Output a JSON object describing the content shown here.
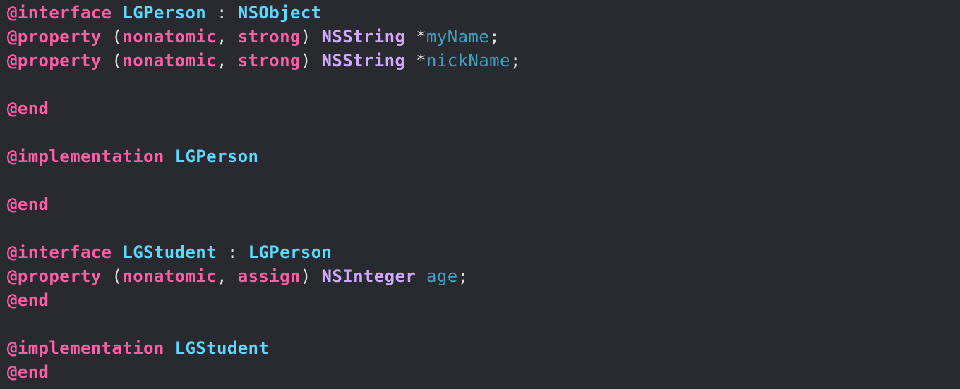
{
  "code": {
    "line1": {
      "kw": "@interface",
      "cls": "LGPerson",
      "colon": " : ",
      "sup": "NSObject"
    },
    "line2": {
      "kw": "@property",
      "open": " (",
      "a1": "nonatomic",
      "comma": ", ",
      "a2": "strong",
      "close": ") ",
      "type": "NSString",
      "star": " *",
      "name": "myName",
      "semi": ";"
    },
    "line3": {
      "kw": "@property",
      "open": " (",
      "a1": "nonatomic",
      "comma": ", ",
      "a2": "strong",
      "close": ") ",
      "type": "NSString",
      "star": " *",
      "name": "nickName",
      "semi": ";"
    },
    "line5": {
      "kw": "@end"
    },
    "line7": {
      "kw": "@implementation",
      "sp": " ",
      "cls": "LGPerson"
    },
    "line9": {
      "kw": "@end"
    },
    "line11": {
      "kw": "@interface",
      "sp": " ",
      "cls": "LGStudent",
      "colon": " : ",
      "sup": "LGPerson"
    },
    "line12": {
      "kw": "@property",
      "open": " (",
      "a1": "nonatomic",
      "comma": ", ",
      "a2": "assign",
      "close": ") ",
      "type": "NSInteger",
      "sp": " ",
      "name": "age",
      "semi": ";"
    },
    "line13": {
      "kw": "@end"
    },
    "line15": {
      "kw": "@implementation",
      "sp": " ",
      "cls": "LGStudent"
    },
    "line16": {
      "kw": "@end"
    }
  }
}
